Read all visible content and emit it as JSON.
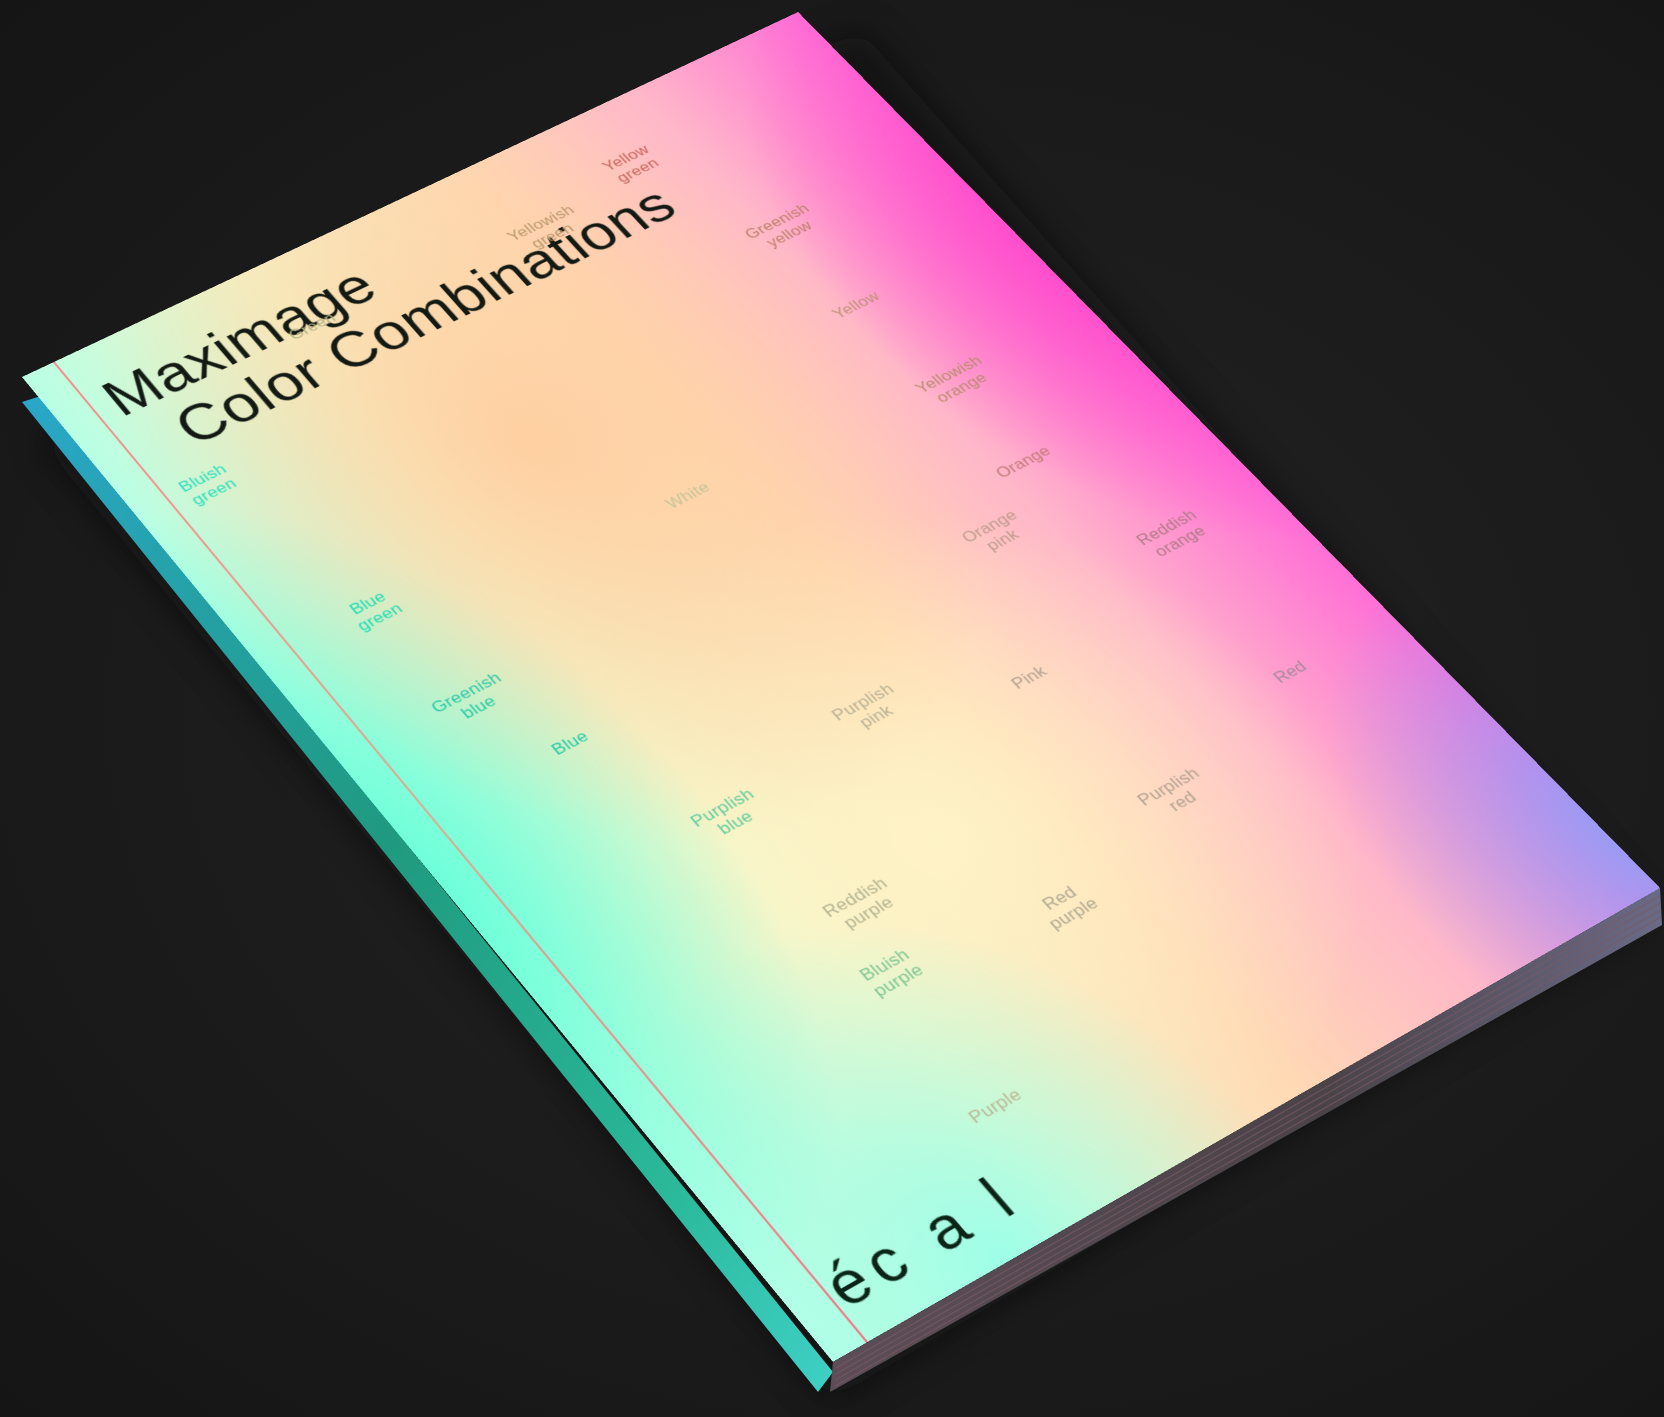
{
  "cover": {
    "title_line1": "Maximage",
    "title_line2": "Color Combinations",
    "logo": "éc a l"
  },
  "labels": [
    {
      "text": "Yellow\ngreen",
      "color": "#c7665c"
    },
    {
      "text": "Yellowish\ngreen",
      "color": "#b9976e"
    },
    {
      "text": "Green",
      "color": "#b2b284"
    },
    {
      "text": "Greenish\nyellow",
      "color": "#bd7f6a"
    },
    {
      "text": "Bluish\ngreen",
      "color": "#2ae0bd"
    },
    {
      "text": "Yellow",
      "color": "#c09179"
    },
    {
      "text": "Blue\ngreen",
      "color": "#1fdcb4"
    },
    {
      "text": "Yellowish\norange",
      "color": "#b88b70"
    },
    {
      "text": "White",
      "color": "#c8c39a"
    },
    {
      "text": "Orange",
      "color": "#c37a7a"
    },
    {
      "text": "Greenish\nblue",
      "color": "#28c9a6"
    },
    {
      "text": "Orange\npink",
      "color": "#bd9d8c"
    },
    {
      "text": "Reddish\norange",
      "color": "#b07a88"
    },
    {
      "text": "Blue",
      "color": "#27c9a7"
    },
    {
      "text": "Pink",
      "color": "#b2a192"
    },
    {
      "text": "Purplish\npink",
      "color": "#b8b195"
    },
    {
      "text": "Red",
      "color": "#a58a9b"
    },
    {
      "text": "Purplish\nblue",
      "color": "#5fcc9e"
    },
    {
      "text": "Purplish\nred",
      "color": "#b2a292"
    },
    {
      "text": "Reddish\npurple",
      "color": "#b3b391"
    },
    {
      "text": "Red\npurple",
      "color": "#b0a892"
    },
    {
      "text": "Bluish\npurple",
      "color": "#7ec593"
    },
    {
      "text": "Purple",
      "color": "#bab894"
    }
  ]
}
